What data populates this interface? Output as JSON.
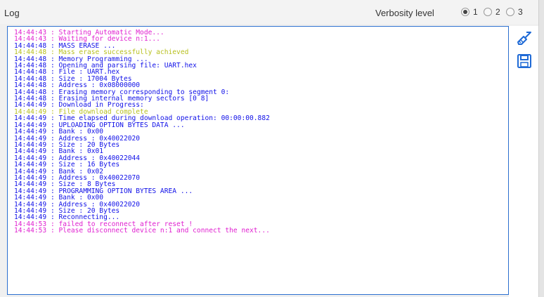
{
  "header": {
    "title": "Log",
    "verbosity_label": "Verbosity level",
    "verbosity_options": [
      "1",
      "2",
      "3"
    ],
    "verbosity_selected": "1"
  },
  "toolbar": {
    "clear_icon": "broom-icon",
    "save_icon": "save-icon"
  },
  "colors": {
    "accent": "#2b6fcf",
    "info": "#1010e8",
    "warning": "#e020d0",
    "success": "#b8c020"
  },
  "log": {
    "lines": [
      {
        "text": "14:44:43 : Starting Automatic Mode...",
        "level": "warning"
      },
      {
        "text": "14:44:43 : Waiting for device n:1...",
        "level": "warning"
      },
      {
        "text": "14:44:48 : MASS ERASE ...",
        "level": "info"
      },
      {
        "text": "14:44:48 : Mass erase successfully achieved",
        "level": "success"
      },
      {
        "text": "14:44:48 : Memory Programming ...",
        "level": "info"
      },
      {
        "text": "14:44:48 : Opening and parsing file: UART.hex",
        "level": "info"
      },
      {
        "text": "14:44:48 : File : UART.hex",
        "level": "info"
      },
      {
        "text": "14:44:48 : Size : 17004 Bytes",
        "level": "info"
      },
      {
        "text": "14:44:48 : Address : 0x08000000",
        "level": "info"
      },
      {
        "text": "14:44:48 : Erasing memory corresponding to segment 0:",
        "level": "info"
      },
      {
        "text": "14:44:48 : Erasing internal memory sectors [0 8]",
        "level": "info"
      },
      {
        "text": "14:44:49 : Download in Progress:",
        "level": "info"
      },
      {
        "text": "14:44:49 : File download complete",
        "level": "success"
      },
      {
        "text": "14:44:49 : Time elapsed during download operation: 00:00:00.882",
        "level": "info"
      },
      {
        "text": "14:44:49 : UPLOADING OPTION BYTES DATA ...",
        "level": "info"
      },
      {
        "text": "14:44:49 : Bank : 0x00",
        "level": "info"
      },
      {
        "text": "14:44:49 : Address : 0x40022020",
        "level": "info"
      },
      {
        "text": "14:44:49 : Size : 20 Bytes",
        "level": "info"
      },
      {
        "text": "14:44:49 : Bank : 0x01",
        "level": "info"
      },
      {
        "text": "14:44:49 : Address : 0x40022044",
        "level": "info"
      },
      {
        "text": "14:44:49 : Size : 16 Bytes",
        "level": "info"
      },
      {
        "text": "14:44:49 : Bank : 0x02",
        "level": "info"
      },
      {
        "text": "14:44:49 : Address : 0x40022070",
        "level": "info"
      },
      {
        "text": "14:44:49 : Size : 8 Bytes",
        "level": "info"
      },
      {
        "text": "14:44:49 : PROGRAMMING OPTION BYTES AREA ...",
        "level": "info"
      },
      {
        "text": "14:44:49 : Bank : 0x00",
        "level": "info"
      },
      {
        "text": "14:44:49 : Address : 0x40022020",
        "level": "info"
      },
      {
        "text": "14:44:49 : Size : 20 Bytes",
        "level": "info"
      },
      {
        "text": "14:44:49 : Reconnecting...",
        "level": "info"
      },
      {
        "text": "14:44:53 : failed to reconnect after reset !",
        "level": "warning"
      },
      {
        "text": "14:44:53 : Please disconnect device n:1 and connect the next...",
        "level": "warning"
      }
    ]
  }
}
